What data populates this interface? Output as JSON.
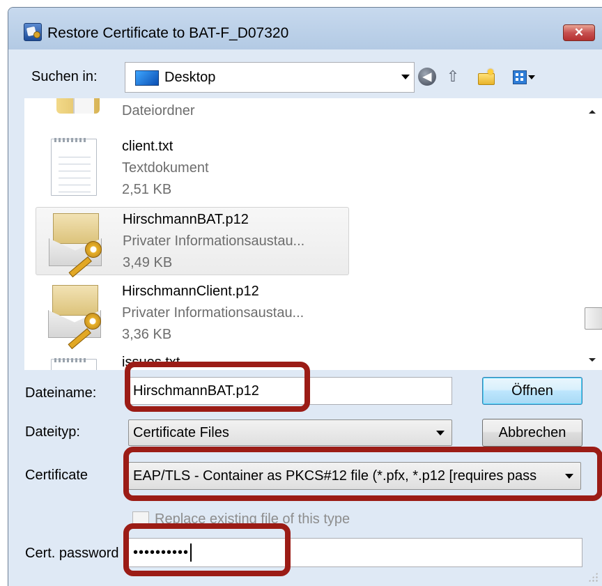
{
  "window": {
    "title": "Restore Certificate to BAT-F_D07320",
    "close_label": "✕"
  },
  "location": {
    "label": "Suchen in:",
    "value": "Desktop"
  },
  "files": [
    {
      "name": "",
      "type": "Dateiordner",
      "size": "",
      "icon": "folder-icon"
    },
    {
      "name": "client.txt",
      "type": "Textdokument",
      "size": "2,51 KB",
      "icon": "text-document-icon"
    },
    {
      "name": "HirschmannBAT.p12",
      "type": "Privater Informationsaustau...",
      "size": "3,49 KB",
      "icon": "certificate-icon",
      "selected": true
    },
    {
      "name": "HirschmannClient.p12",
      "type": "Privater Informationsaustau...",
      "size": "3,36 KB",
      "icon": "certificate-icon"
    },
    {
      "name": "issues.txt",
      "type": "",
      "size": "",
      "icon": "text-document-icon"
    }
  ],
  "form": {
    "filename_label": "Dateiname:",
    "filename_value": "HirschmannBAT.p12",
    "filetype_label": "Dateityp:",
    "filetype_value": "Certificate Files",
    "certificate_label": "Certificate",
    "certificate_value": "EAP/TLS - Container as PKCS#12 file (*.pfx, *.p12 [requires pass",
    "replace_label": "Replace existing file of this type",
    "password_label": "Cert. password",
    "password_value": "••••••••••"
  },
  "buttons": {
    "open": "Öffnen",
    "cancel": "Abbrechen"
  },
  "colors": {
    "dialog_bg": "#dfe9f5",
    "highlight": "#9b1c16",
    "default_button_border": "#3c7fb1"
  }
}
